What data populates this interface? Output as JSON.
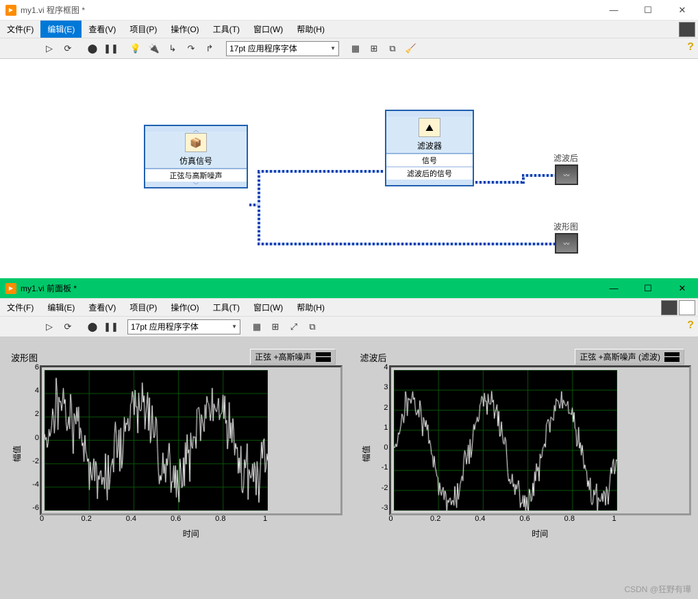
{
  "windows": {
    "block_diagram": {
      "title": "my1.vi 程序框图 *"
    },
    "front_panel": {
      "title": "my1.vi 前面板 *"
    }
  },
  "menu": {
    "items": [
      "文件(F)",
      "编辑(E)",
      "查看(V)",
      "项目(P)",
      "操作(O)",
      "工具(T)",
      "窗口(W)",
      "帮助(H)"
    ],
    "highlighted_index_bd": 1
  },
  "toolbar": {
    "font_label": "17pt 应用程序字体"
  },
  "diagram": {
    "sim_node": {
      "title": "仿真信号",
      "output_row": "正弦与高斯噪声"
    },
    "filter_node": {
      "title": "滤波器",
      "rows": [
        "信号",
        "滤波后的信号"
      ]
    },
    "terminals": {
      "filtered": "滤波后",
      "waveform": "波形图"
    }
  },
  "front": {
    "graph1": {
      "title": "波形图",
      "legend": "正弦  +高斯噪声",
      "ylabel": "幅值",
      "xlabel": "时间"
    },
    "graph2": {
      "title": "滤波后",
      "legend": "正弦  +高斯噪声 (滤波)",
      "ylabel": "幅值",
      "xlabel": "时间"
    }
  },
  "watermark": "CSDN @狂野有璍",
  "chart_data": [
    {
      "type": "line",
      "title": "波形图",
      "xlabel": "时间",
      "ylabel": "幅值",
      "xlim": [
        0,
        1
      ],
      "ylim": [
        -6,
        6
      ],
      "xticks": [
        0,
        0.2,
        0.4,
        0.6,
        0.8,
        1
      ],
      "yticks": [
        -6,
        -4,
        -2,
        0,
        2,
        4,
        6
      ],
      "series": [
        {
          "name": "正弦+高斯噪声",
          "noisy": true,
          "freq": 3,
          "amp": 3,
          "noise": 2,
          "n": 250
        }
      ]
    },
    {
      "type": "line",
      "title": "滤波后",
      "xlabel": "时间",
      "ylabel": "幅值",
      "xlim": [
        0,
        1
      ],
      "ylim": [
        -3,
        4
      ],
      "xticks": [
        0,
        0.2,
        0.4,
        0.6,
        0.8,
        1
      ],
      "yticks": [
        -3,
        -2,
        -1,
        0,
        1,
        2,
        3,
        4
      ],
      "series": [
        {
          "name": "正弦+高斯噪声(滤波)",
          "noisy": true,
          "freq": 3,
          "amp": 2.5,
          "noise": 0.6,
          "n": 250
        }
      ]
    }
  ]
}
